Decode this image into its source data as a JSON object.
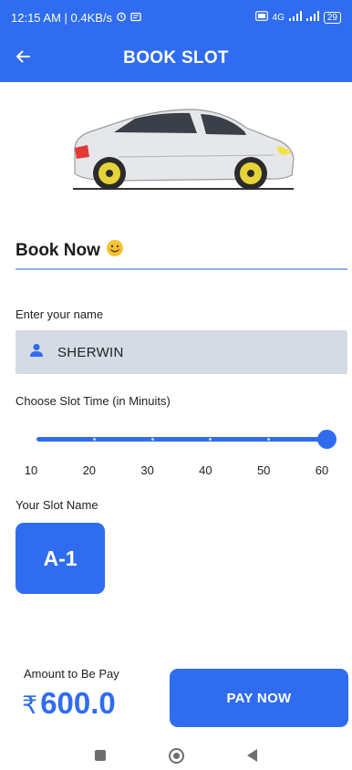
{
  "status_bar": {
    "time_speed": "12:15 AM | 0.4KB/s",
    "network": "4G",
    "battery": "29"
  },
  "app_bar": {
    "title": "BOOK SLOT"
  },
  "form": {
    "heading": "Book Now",
    "heading_emoji": "😊",
    "name_label": "Enter your name",
    "name_value": "SHERWIN",
    "slot_time_label": "Choose Slot Time (in Minuits)",
    "slider": {
      "min": 10,
      "max": 60,
      "value": 60,
      "ticks": [
        "10",
        "20",
        "30",
        "40",
        "50",
        "60"
      ]
    },
    "slot_name_label": "Your Slot Name",
    "slot_name": "A-1"
  },
  "footer": {
    "amount_label": "Amount to Be Pay",
    "currency_symbol": "₹",
    "amount": "600.0",
    "pay_button": "PAY NOW"
  },
  "colors": {
    "primary": "#2f6cf0",
    "field_bg": "#d5dbe5"
  },
  "icons": {
    "back": "arrow-left-icon",
    "name_field": "person-icon",
    "nav": [
      "recents-square-icon",
      "home-circle-icon",
      "back-triangle-icon"
    ]
  }
}
